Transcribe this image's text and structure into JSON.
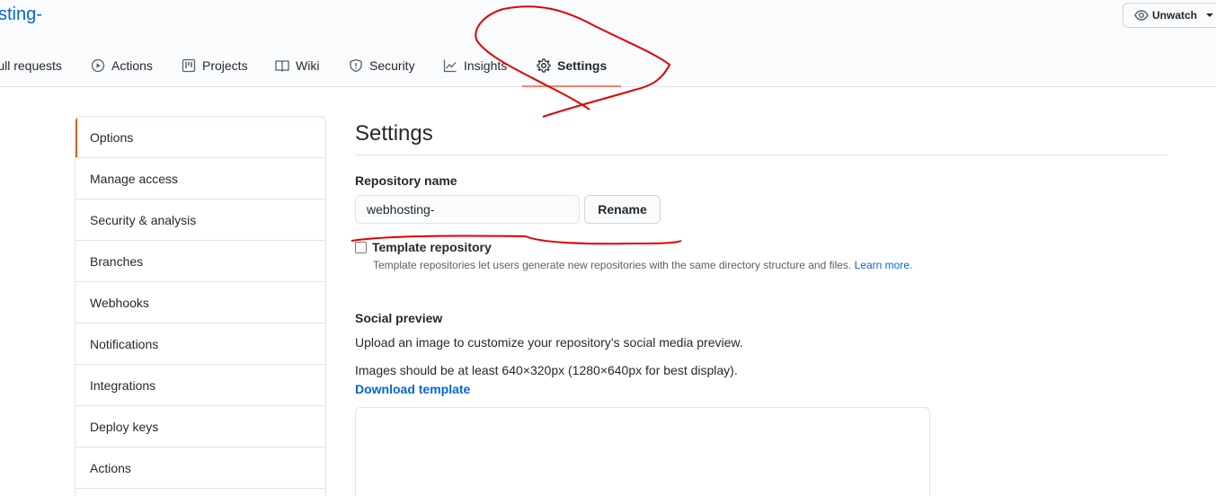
{
  "header": {
    "repo_title": "sting-",
    "watch_label": "Unwatch"
  },
  "tabs": [
    {
      "label": "Pull requests",
      "icon": "pull-request-icon"
    },
    {
      "label": "Actions",
      "icon": "play-icon"
    },
    {
      "label": "Projects",
      "icon": "project-icon"
    },
    {
      "label": "Wiki",
      "icon": "book-icon"
    },
    {
      "label": "Security",
      "icon": "shield-icon"
    },
    {
      "label": "Insights",
      "icon": "graph-icon"
    },
    {
      "label": "Settings",
      "icon": "gear-icon",
      "selected": true
    }
  ],
  "sidebar": {
    "items": [
      {
        "label": "Options",
        "selected": true
      },
      {
        "label": "Manage access"
      },
      {
        "label": "Security & analysis"
      },
      {
        "label": "Branches"
      },
      {
        "label": "Webhooks"
      },
      {
        "label": "Notifications"
      },
      {
        "label": "Integrations"
      },
      {
        "label": "Deploy keys"
      },
      {
        "label": "Actions"
      }
    ]
  },
  "main": {
    "title": "Settings",
    "repo_name_label": "Repository name",
    "repo_name_value": "webhosting-",
    "rename_label": "Rename",
    "template_label": "Template repository",
    "template_note": "Template repositories let users generate new repositories with the same directory structure and files.",
    "learn_more": "Learn more.",
    "social_label": "Social preview",
    "social_text1": "Upload an image to customize your repository’s social media preview.",
    "social_text2": "Images should be at least 640×320px (1280×640px for best display).",
    "download_template": "Download template"
  },
  "colors": {
    "link": "#0366d6",
    "selected_underline": "#f9826c",
    "annotation": "#e00000"
  }
}
